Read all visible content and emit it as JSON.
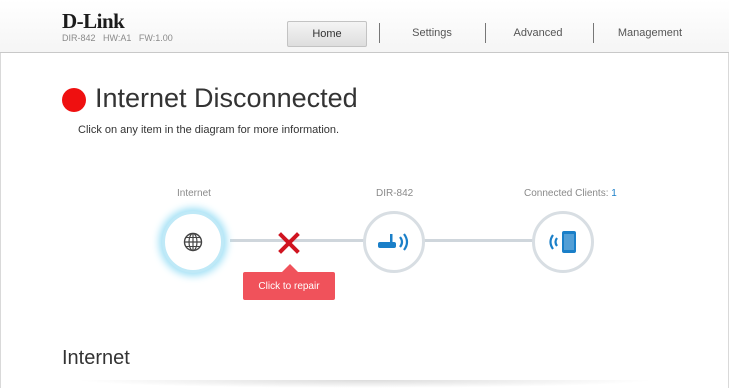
{
  "header": {
    "brand": "D-Link",
    "model": "DIR-842",
    "hw": "HW:A1",
    "fw": "FW:1.00"
  },
  "nav": {
    "home": "Home",
    "settings": "Settings",
    "advanced": "Advanced",
    "management": "Management",
    "active": "Home"
  },
  "status": {
    "title": "Internet Disconnected",
    "hint": "Click on any item in the diagram for more information.",
    "color": "#ef1010"
  },
  "diagram": {
    "internet_label": "Internet",
    "router_label": "DIR-842",
    "clients_label": "Connected Clients:",
    "clients_count": "1",
    "repair_label": "Click to repair",
    "icons": [
      "globe-icon",
      "router-icon",
      "mobile-device-icon",
      "disconnect-x-icon"
    ]
  },
  "section": {
    "title": "Internet"
  },
  "colors": {
    "accent": "#1a7fc8",
    "error": "#f0525b",
    "glow": "#9fe0f6"
  }
}
